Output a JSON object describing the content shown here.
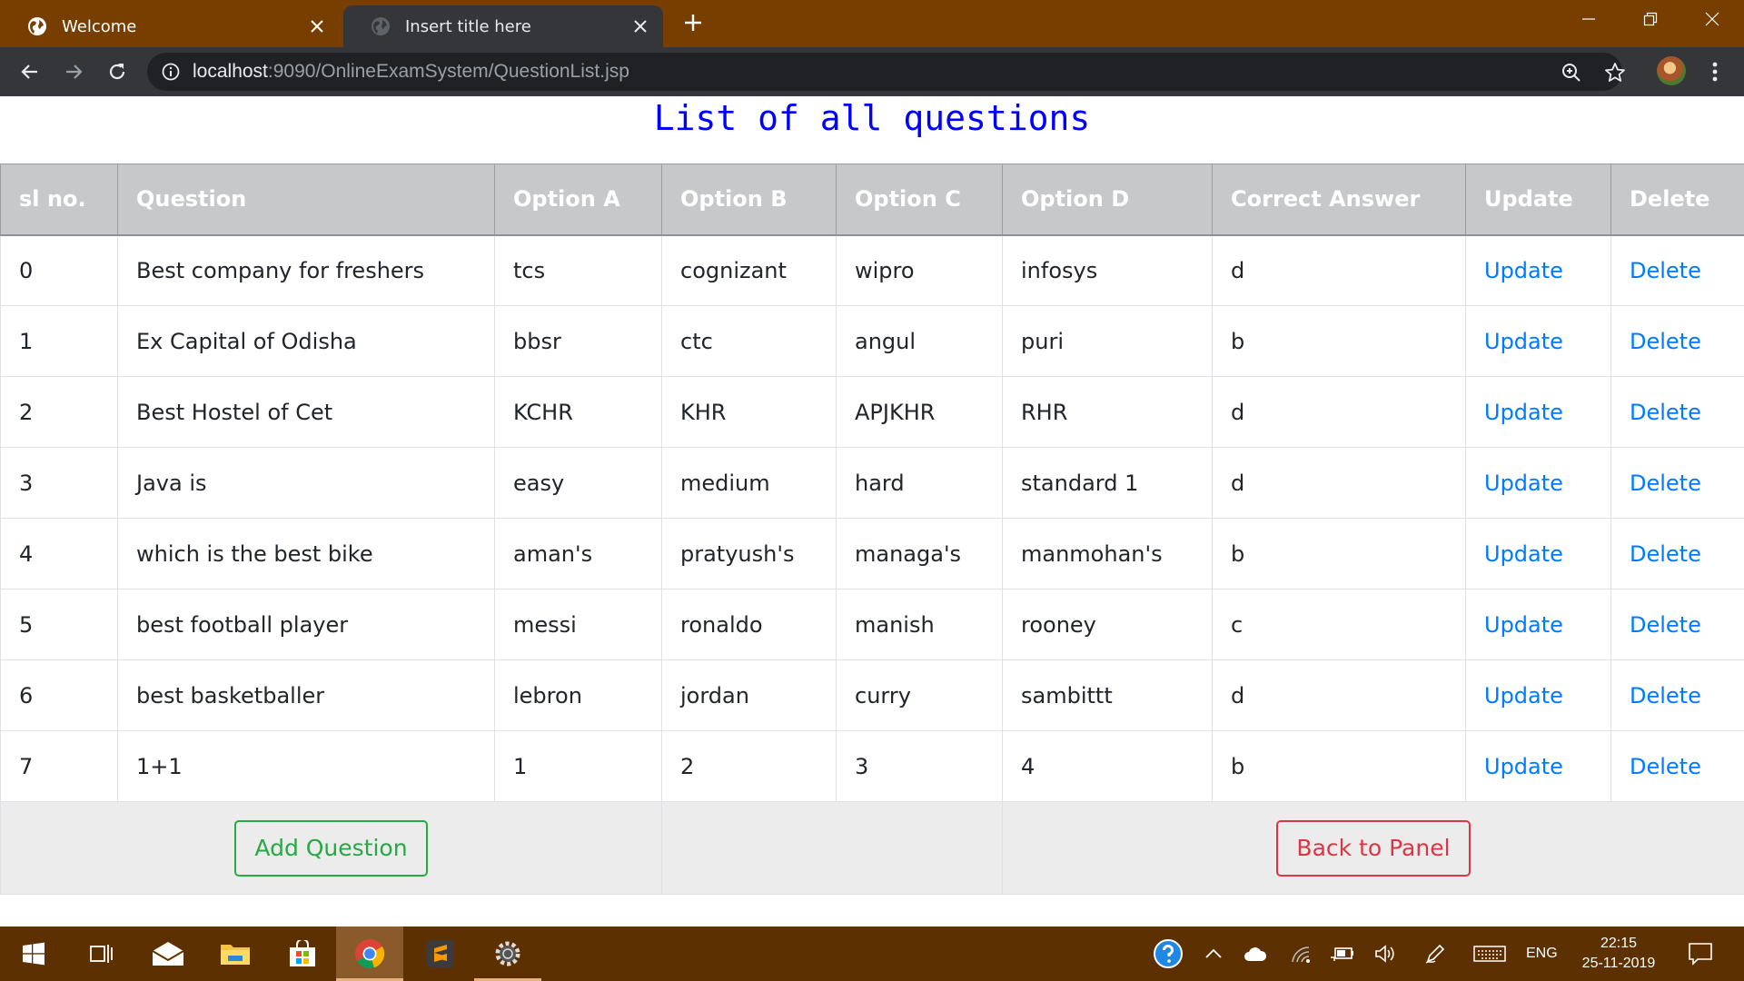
{
  "browser": {
    "tabs": [
      {
        "title": "Welcome",
        "active": false
      },
      {
        "title": "Insert title here",
        "active": true
      }
    ],
    "url_host": "localhost",
    "url_rest": ":9090/OnlineExamSystem/QuestionList.jsp"
  },
  "page": {
    "title": "List of all questions",
    "table": {
      "headers": [
        "sl no.",
        "Question",
        "Option A",
        "Option B",
        "Option C",
        "Option D",
        "Correct Answer",
        "Update",
        "Delete"
      ],
      "rows": [
        [
          "0",
          "Best company for freshers",
          "tcs",
          "cognizant",
          "wipro",
          "infosys",
          "d",
          "Update",
          "Delete"
        ],
        [
          "1",
          "Ex Capital of Odisha",
          "bbsr",
          "ctc",
          "angul",
          "puri",
          "b",
          "Update",
          "Delete"
        ],
        [
          "2",
          "Best Hostel of Cet",
          "KCHR",
          "KHR",
          "APJKHR",
          "RHR",
          "d",
          "Update",
          "Delete"
        ],
        [
          "3",
          "Java is",
          "easy",
          "medium",
          "hard",
          "standard 1",
          "d",
          "Update",
          "Delete"
        ],
        [
          "4",
          "which is the best bike",
          "aman's",
          "pratyush's",
          "managa's",
          "manmohan's",
          "b",
          "Update",
          "Delete"
        ],
        [
          "5",
          "best football player",
          "messi",
          "ronaldo",
          "manish",
          "rooney",
          "c",
          "Update",
          "Delete"
        ],
        [
          "6",
          "best basketballer",
          "lebron",
          "jordan",
          "curry",
          "sambittt",
          "d",
          "Update",
          "Delete"
        ],
        [
          "7",
          "1+1",
          "1",
          "2",
          "3",
          "4",
          "b",
          "Update",
          "Delete"
        ]
      ]
    },
    "add_question_label": "Add Question",
    "back_to_panel_label": "Back to Panel"
  },
  "taskbar": {
    "language": "ENG",
    "time": "22:15",
    "date": "25-11-2019"
  },
  "colors": {
    "tabstrip": "#773e00",
    "toolbar": "#35363a",
    "title": "#0000ff",
    "table_header": "#c6c8ca",
    "link": "#007bff",
    "success": "#28a745",
    "danger": "#dc3545",
    "taskbar": "#5c3000"
  }
}
